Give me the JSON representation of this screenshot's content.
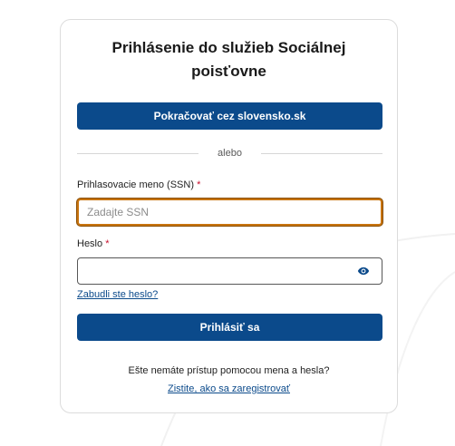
{
  "login": {
    "title": "Prihlásenie do služieb Sociálnej poisťovne",
    "sso_button_label": "Pokračovať cez slovensko.sk",
    "divider_label": "alebo",
    "username_label": "Prihlasovacie meno (SSN)",
    "username_required_mark": "*",
    "username_placeholder": "Zadajte SSN",
    "username_value": "",
    "password_label": "Heslo",
    "password_required_mark": "*",
    "password_value": "",
    "show_password_icon": "eye-icon",
    "forgot_password_link": "Zabudli ste heslo?",
    "login_button_label": "Prihlásiť sa",
    "no_access_text": "Ešte nemáte prístup pomocou mena a hesla?",
    "register_link": "Zistite, ako sa zaregistrovať"
  },
  "colors": {
    "primary": "#0b4a8b",
    "focus_outline": "#c8740f",
    "required": "#c8102e",
    "card_border": "#dcdcdc"
  }
}
